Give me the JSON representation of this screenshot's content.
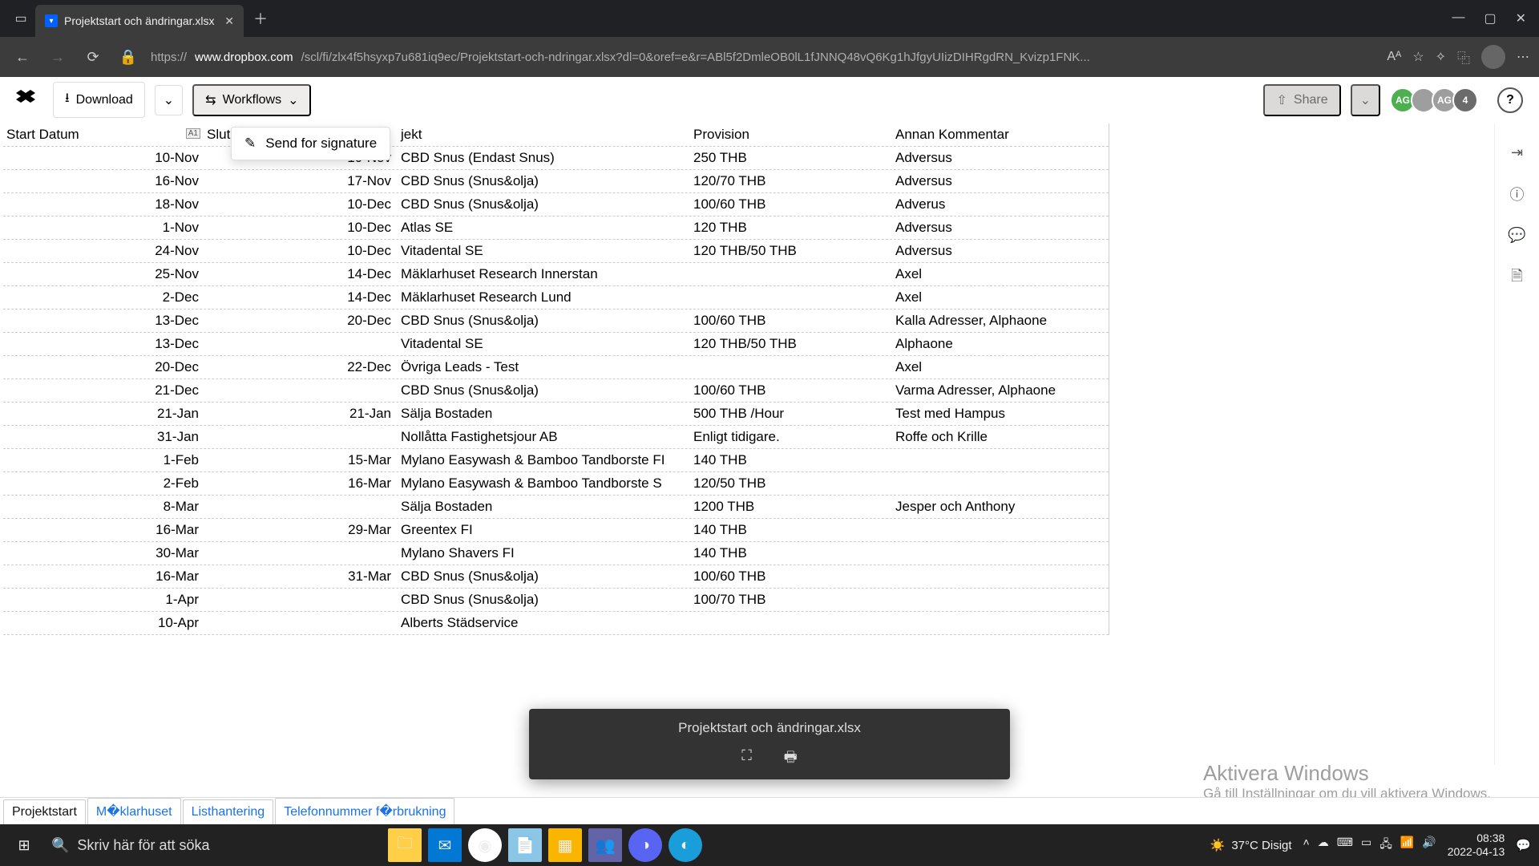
{
  "browser": {
    "tab_title": "Projektstart och ändringar.xlsx",
    "url_prefix": "https://",
    "url_domain": "www.dropbox.com",
    "url_path": "/scl/fi/zlx4f5hsyxp7u681iq9ec/Projektstart-och-ndringar.xlsx?dl=0&oref=e&r=ABl5f2DmleOB0lL1fJNNQ48vQ6Kg1hJfgyUIizDIHRgdRN_Kvizp1FNK..."
  },
  "toolbar": {
    "download_label": "Download",
    "workflows_label": "Workflows",
    "share_label": "Share",
    "avatar1": "AG",
    "avatar3": "AG",
    "avatar_count": "4",
    "help_label": "?"
  },
  "workflows_menu": {
    "send_for_signature": "Send for signature"
  },
  "sheet": {
    "cell_ref": "A1",
    "headers": {
      "start": "Start Datum",
      "slut": "Slut",
      "projekt": "jekt",
      "provision": "Provision",
      "kommentar": "Annan Kommentar"
    },
    "rows": [
      {
        "start": "10-Nov",
        "slut": "10-Nov",
        "projekt": "CBD Snus (Endast Snus)",
        "provision": "250 THB",
        "kommentar": "Adversus"
      },
      {
        "start": "16-Nov",
        "slut": "17-Nov",
        "projekt": "CBD Snus (Snus&olja)",
        "provision": "120/70 THB",
        "kommentar": "Adversus"
      },
      {
        "start": "18-Nov",
        "slut": "10-Dec",
        "projekt": "CBD Snus (Snus&olja)",
        "provision": "100/60 THB",
        "kommentar": "Adverus"
      },
      {
        "start": "1-Nov",
        "slut": "10-Dec",
        "projekt": "Atlas SE",
        "provision": "120 THB",
        "kommentar": "Adversus"
      },
      {
        "start": "24-Nov",
        "slut": "10-Dec",
        "projekt": "Vitadental SE",
        "provision": "120 THB/50 THB",
        "kommentar": "Adversus"
      },
      {
        "start": "25-Nov",
        "slut": "14-Dec",
        "projekt": "Mäklarhuset Research Innerstan",
        "provision": "",
        "kommentar": "Axel"
      },
      {
        "start": "2-Dec",
        "slut": "14-Dec",
        "projekt": "Mäklarhuset Research Lund",
        "provision": "",
        "kommentar": "Axel"
      },
      {
        "start": "13-Dec",
        "slut": "20-Dec",
        "projekt": "CBD Snus (Snus&olja)",
        "provision": "100/60 THB",
        "kommentar": "Kalla Adresser, Alphaone"
      },
      {
        "start": "13-Dec",
        "slut": "",
        "projekt": "Vitadental SE",
        "provision": "120 THB/50 THB",
        "kommentar": "Alphaone"
      },
      {
        "start": "20-Dec",
        "slut": "22-Dec",
        "projekt": "Övriga Leads - Test",
        "provision": "",
        "kommentar": "Axel"
      },
      {
        "start": "21-Dec",
        "slut": "",
        "projekt": "CBD Snus (Snus&olja)",
        "provision": "100/60 THB",
        "kommentar": "Varma Adresser, Alphaone"
      },
      {
        "start": "21-Jan",
        "slut": "21-Jan",
        "projekt": "Sälja Bostaden",
        "provision": "500 THB /Hour",
        "kommentar": "Test med Hampus"
      },
      {
        "start": "31-Jan",
        "slut": "",
        "projekt": "Nollåtta Fastighetsjour AB",
        "provision": "Enligt tidigare.",
        "kommentar": "Roffe och Krille"
      },
      {
        "start": "1-Feb",
        "slut": "15-Mar",
        "projekt": "Mylano Easywash & Bamboo Tandborste FI",
        "provision": "140 THB",
        "kommentar": ""
      },
      {
        "start": "2-Feb",
        "slut": "16-Mar",
        "projekt": "Mylano Easywash & Bamboo Tandborste S",
        "provision": "120/50 THB",
        "kommentar": ""
      },
      {
        "start": "8-Mar",
        "slut": "",
        "projekt": "Sälja Bostaden",
        "provision": "1200 THB",
        "kommentar": "Jesper och Anthony"
      },
      {
        "start": "16-Mar",
        "slut": "29-Mar",
        "projekt": "Greentex FI",
        "provision": "140 THB",
        "kommentar": ""
      },
      {
        "start": "30-Mar",
        "slut": "",
        "projekt": "Mylano Shavers FI",
        "provision": "140 THB",
        "kommentar": ""
      },
      {
        "start": "16-Mar",
        "slut": "31-Mar",
        "projekt": "CBD Snus (Snus&olja)",
        "provision": "100/60 THB",
        "kommentar": ""
      },
      {
        "start": "1-Apr",
        "slut": "",
        "projekt": "CBD Snus (Snus&olja)",
        "provision": "100/70 THB",
        "kommentar": ""
      },
      {
        "start": "10-Apr",
        "slut": "",
        "projekt": "Alberts Städservice",
        "provision": "",
        "kommentar": ""
      }
    ]
  },
  "viewer": {
    "filename": "Projektstart och ändringar.xlsx"
  },
  "watermark": {
    "title": "Aktivera Windows",
    "subtitle": "Gå till Inställningar om du vill aktivera Windows."
  },
  "tabs": {
    "t1": "Projektstart",
    "t2": "M�klarhuset",
    "t3": "Listhantering",
    "t4": "Telefonnummer f�rbrukning"
  },
  "taskbar": {
    "search_placeholder": "Skriv här för att söka",
    "weather": "37°C  Disigt",
    "time": "08:38",
    "date": "2022-04-13"
  }
}
